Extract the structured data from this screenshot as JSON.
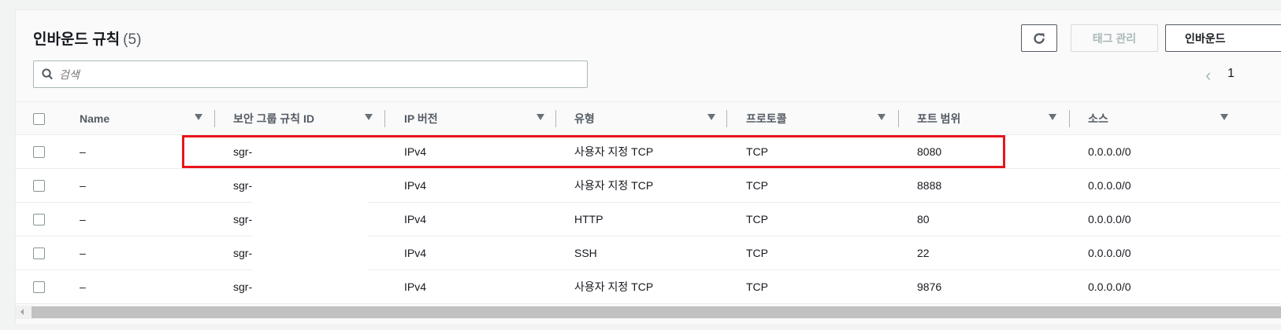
{
  "header": {
    "title": "인바운드 규칙",
    "count": "(5)",
    "tag_button": "태그 관리",
    "inbound_button": "인바운드"
  },
  "search": {
    "placeholder": "검색"
  },
  "pagination": {
    "page": "1"
  },
  "columns": [
    "Name",
    "보안 그룹 규칙 ID",
    "IP 버전",
    "유형",
    "프로토콜",
    "포트 범위",
    "소스"
  ],
  "rows": [
    {
      "name": "–",
      "id": "sgr-",
      "ip": "IPv4",
      "type": "사용자 지정 TCP",
      "protocol": "TCP",
      "port": "8080",
      "source": "0.0.0.0/0"
    },
    {
      "name": "–",
      "id": "sgr-",
      "ip": "IPv4",
      "type": "사용자 지정 TCP",
      "protocol": "TCP",
      "port": "8888",
      "source": "0.0.0.0/0"
    },
    {
      "name": "–",
      "id": "sgr-",
      "ip": "IPv4",
      "type": "HTTP",
      "protocol": "TCP",
      "port": "80",
      "source": "0.0.0.0/0"
    },
    {
      "name": "–",
      "id": "sgr-",
      "ip": "IPv4",
      "type": "SSH",
      "protocol": "TCP",
      "port": "22",
      "source": "0.0.0.0/0"
    },
    {
      "name": "–",
      "id": "sgr-",
      "ip": "IPv4",
      "type": "사용자 지정 TCP",
      "protocol": "TCP",
      "port": "9876",
      "source": "0.0.0.0/0"
    }
  ],
  "highlight_color": "#e8141c"
}
